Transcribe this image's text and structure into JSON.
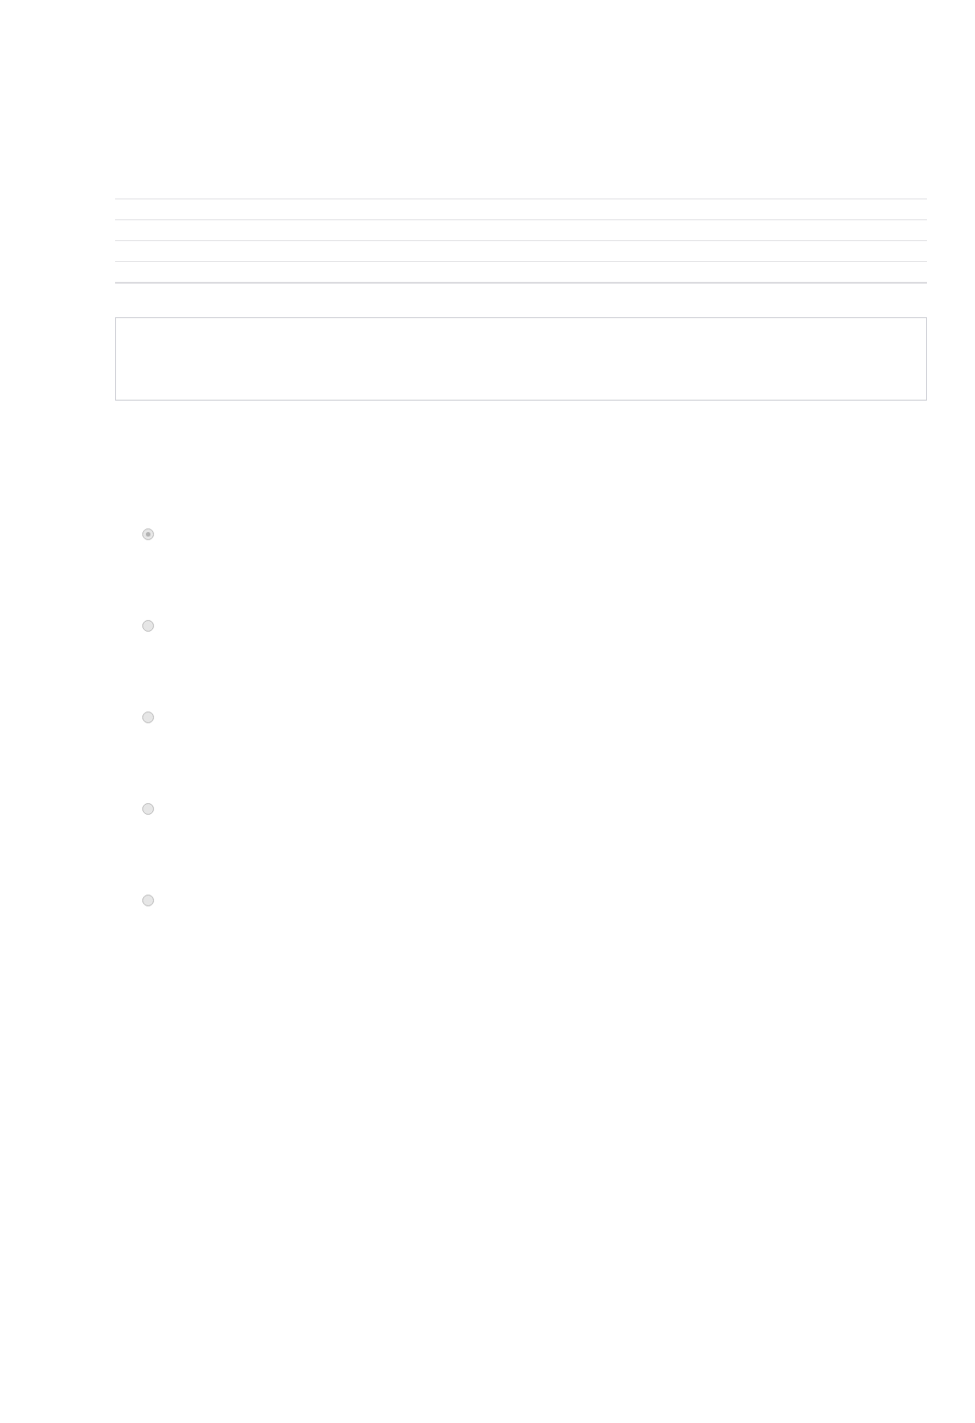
{
  "comment_box": {
    "disabled": true
  },
  "options": [
    {
      "selected": true,
      "disabled": true
    },
    {
      "selected": false,
      "disabled": true
    },
    {
      "selected": false,
      "disabled": true
    },
    {
      "selected": false,
      "disabled": true
    },
    {
      "selected": false,
      "disabled": true
    }
  ]
}
